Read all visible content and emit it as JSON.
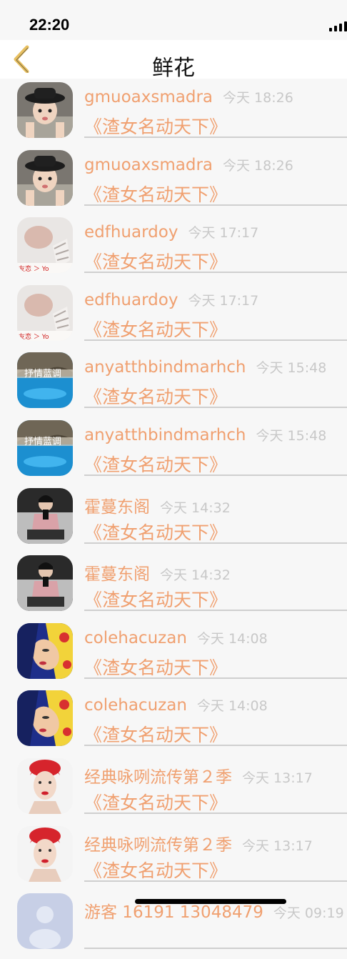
{
  "status": {
    "time": "22:20"
  },
  "nav": {
    "title": "鲜花",
    "back_icon": "chevron-left-icon"
  },
  "colors": {
    "accent": "#f0a070",
    "time_gray": "#c8c8c8",
    "divider": "#cfcfcf",
    "back_icon": "#e8c060"
  },
  "rows": [
    {
      "name": "gmuoaxsmadra",
      "time": "今天 18:26",
      "gift": "《渣女名动天下》",
      "avatar": "girl-hat-photo"
    },
    {
      "name": "gmuoaxsmadra",
      "time": "今天 18:26",
      "gift": "《渣女名动天下》",
      "avatar": "girl-hat-photo"
    },
    {
      "name": "edfhuardoy",
      "time": "今天 17:17",
      "gift": "《渣女名动天下》",
      "avatar": "portrait-hand-photo"
    },
    {
      "name": "edfhuardoy",
      "time": "今天 17:17",
      "gift": "《渣女名动天下》",
      "avatar": "portrait-hand-photo"
    },
    {
      "name": "anyatthbindmarhch",
      "time": "今天 15:48",
      "gift": "《渣女名动天下》",
      "avatar": "blue-water-photo"
    },
    {
      "name": "anyatthbindmarhch",
      "time": "今天 15:48",
      "gift": "《渣女名动天下》",
      "avatar": "blue-water-photo"
    },
    {
      "name": "霍蔓东阁",
      "time": "今天 14:32",
      "gift": "《渣女名动天下》",
      "avatar": "man-pink-shirt-photo"
    },
    {
      "name": "霍蔓东阁",
      "time": "今天 14:32",
      "gift": "《渣女名动天下》",
      "avatar": "man-pink-shirt-photo"
    },
    {
      "name": "colehacuzan",
      "time": "今天 14:08",
      "gift": "《渣女名动天下》",
      "avatar": "blue-flower-girl-photo"
    },
    {
      "name": "colehacuzan",
      "time": "今天 14:08",
      "gift": "《渣女名动天下》",
      "avatar": "blue-flower-girl-photo"
    },
    {
      "name": "经典咏咧流传第２季",
      "time": "今天 13:17",
      "gift": "《渣女名动天下》",
      "avatar": "red-turban-woman-photo"
    },
    {
      "name": "经典咏咧流传第２季",
      "time": "今天 13:17",
      "gift": "《渣女名动天下》",
      "avatar": "red-turban-woman-photo"
    },
    {
      "name": "游客 16191 13048479",
      "time": "今天 09:19",
      "gift": "",
      "avatar": "default-user-avatar"
    }
  ]
}
